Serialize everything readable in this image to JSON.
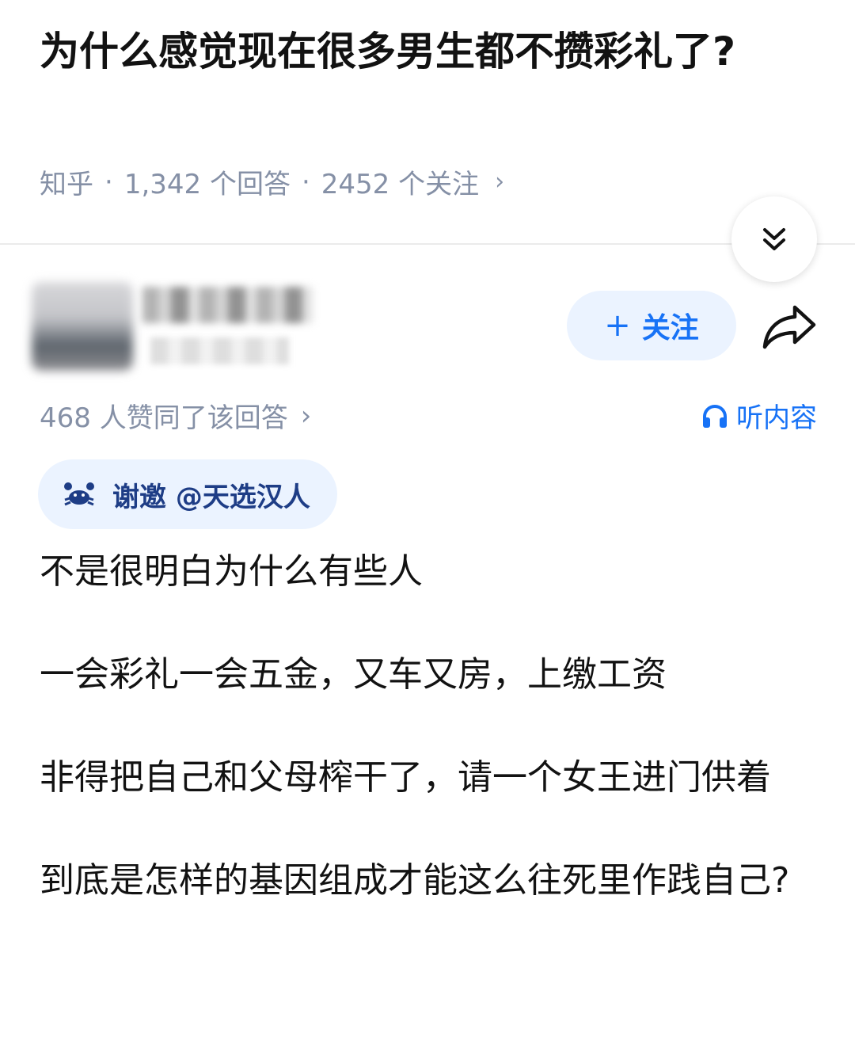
{
  "question": {
    "title": "为什么感觉现在很多男生都不攒彩礼了?",
    "source": "知乎",
    "answer_count": "1,342 个回答",
    "follower_count": "2452 个关注"
  },
  "author": {
    "follow_label": "关注"
  },
  "answer_meta": {
    "upvotes": "468 人赞同了该回答",
    "listen_label": "听内容",
    "invite_label": "谢邀 @天选汉人"
  },
  "answer": {
    "paragraphs": [
      "不是很明白为什么有些人",
      "一会彩礼一会五金，又车又房，上缴工资",
      "非得把自己和父母榨干了，请一个女王进门供着",
      "到底是怎样的基因组成才能这么往死里作践自己?"
    ]
  },
  "icons": {
    "collapse": "chevron-double-down-icon",
    "share": "share-arrow-icon",
    "listen": "headphones-icon",
    "invite": "crab-icon"
  },
  "colors": {
    "accent": "#1772f6",
    "chip_background": "#ebf3ff",
    "meta_gray": "#8590a6"
  }
}
